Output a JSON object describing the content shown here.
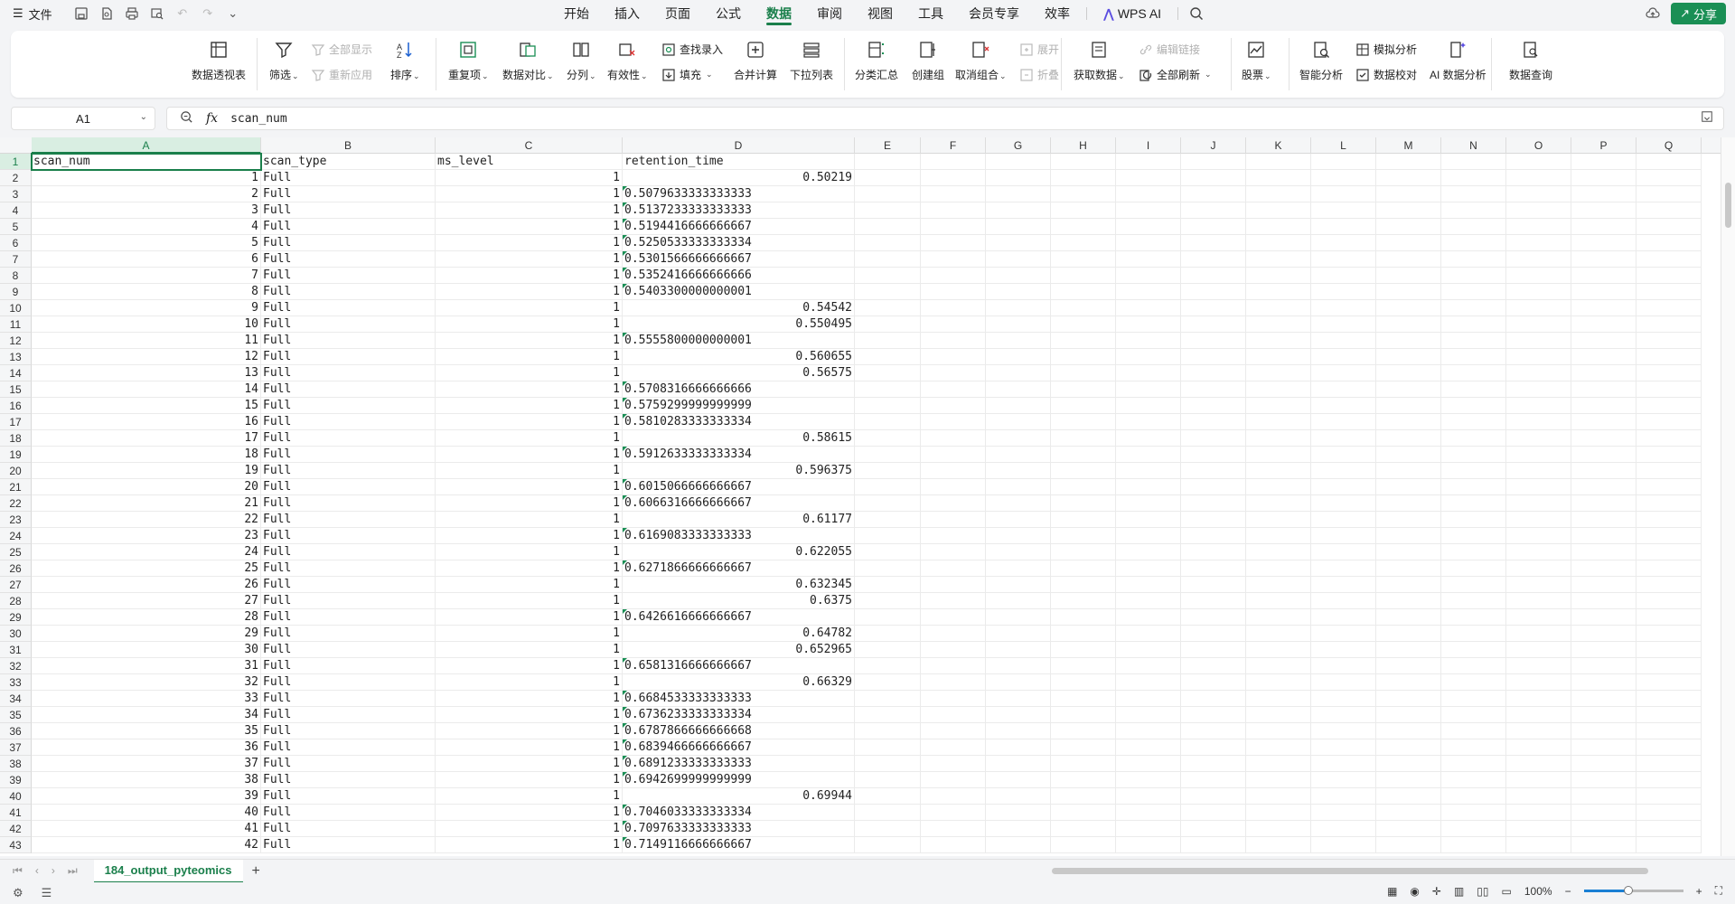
{
  "menubar": {
    "file_label": "文件",
    "menus": [
      {
        "label": "开始",
        "active": false
      },
      {
        "label": "插入",
        "active": false
      },
      {
        "label": "页面",
        "active": false
      },
      {
        "label": "公式",
        "active": false
      },
      {
        "label": "数据",
        "active": true
      },
      {
        "label": "审阅",
        "active": false
      },
      {
        "label": "视图",
        "active": false
      },
      {
        "label": "工具",
        "active": false
      },
      {
        "label": "会员专享",
        "active": false
      },
      {
        "label": "效率",
        "active": false
      }
    ],
    "wps_ai_label": "WPS AI",
    "share_label": "分享"
  },
  "ribbon": {
    "pivot": "数据透视表",
    "filter": "筛选",
    "show_all": "全部显示",
    "reapply": "重新应用",
    "sort": "排序",
    "duplicates": "重复项",
    "compare": "数据对比",
    "split": "分列",
    "validity": "有效性",
    "find_entry": "查找录入",
    "fill": "填充",
    "consolidate": "合并计算",
    "dropdown": "下拉列表",
    "subtotal": "分类汇总",
    "group": "创建组",
    "ungroup": "取消组合",
    "expand": "展开",
    "collapse": "折叠",
    "get_data": "获取数据",
    "edit_links": "编辑链接",
    "refresh_all": "全部刷新",
    "stocks": "股票",
    "smart_analysis": "智能分析",
    "simulate": "模拟分析",
    "verify": "数据校对",
    "ai_analysis": "AI 数据分析",
    "query": "数据查询"
  },
  "formula_bar": {
    "name_box": "A1",
    "fx_label": "fx",
    "content": "scan_num"
  },
  "grid": {
    "columns": [
      "A",
      "B",
      "C",
      "D",
      "E",
      "F",
      "G",
      "H",
      "I",
      "J",
      "K",
      "L",
      "M",
      "N",
      "O",
      "P",
      "Q"
    ],
    "header_row": [
      "scan_num",
      "scan_type",
      "ms_level",
      "retention_time"
    ],
    "rows": [
      [
        "1",
        "Full",
        "1",
        "0.50219"
      ],
      [
        "2",
        "Full",
        "1",
        "0.5079633333333333"
      ],
      [
        "3",
        "Full",
        "1",
        "0.5137233333333333"
      ],
      [
        "4",
        "Full",
        "1",
        "0.5194416666666667"
      ],
      [
        "5",
        "Full",
        "1",
        "0.5250533333333334"
      ],
      [
        "6",
        "Full",
        "1",
        "0.5301566666666667"
      ],
      [
        "7",
        "Full",
        "1",
        "0.5352416666666666"
      ],
      [
        "8",
        "Full",
        "1",
        "0.5403300000000001"
      ],
      [
        "9",
        "Full",
        "1",
        "0.54542"
      ],
      [
        "10",
        "Full",
        "1",
        "0.550495"
      ],
      [
        "11",
        "Full",
        "1",
        "0.5555800000000001"
      ],
      [
        "12",
        "Full",
        "1",
        "0.560655"
      ],
      [
        "13",
        "Full",
        "1",
        "0.56575"
      ],
      [
        "14",
        "Full",
        "1",
        "0.5708316666666666"
      ],
      [
        "15",
        "Full",
        "1",
        "0.5759299999999999"
      ],
      [
        "16",
        "Full",
        "1",
        "0.5810283333333334"
      ],
      [
        "17",
        "Full",
        "1",
        "0.58615"
      ],
      [
        "18",
        "Full",
        "1",
        "0.5912633333333334"
      ],
      [
        "19",
        "Full",
        "1",
        "0.596375"
      ],
      [
        "20",
        "Full",
        "1",
        "0.6015066666666667"
      ],
      [
        "21",
        "Full",
        "1",
        "0.6066316666666667"
      ],
      [
        "22",
        "Full",
        "1",
        "0.61177"
      ],
      [
        "23",
        "Full",
        "1",
        "0.6169083333333333"
      ],
      [
        "24",
        "Full",
        "1",
        "0.622055"
      ],
      [
        "25",
        "Full",
        "1",
        "0.6271866666666667"
      ],
      [
        "26",
        "Full",
        "1",
        "0.632345"
      ],
      [
        "27",
        "Full",
        "1",
        "0.6375"
      ],
      [
        "28",
        "Full",
        "1",
        "0.6426616666666667"
      ],
      [
        "29",
        "Full",
        "1",
        "0.64782"
      ],
      [
        "30",
        "Full",
        "1",
        "0.652965"
      ],
      [
        "31",
        "Full",
        "1",
        "0.6581316666666667"
      ],
      [
        "32",
        "Full",
        "1",
        "0.66329"
      ],
      [
        "33",
        "Full",
        "1",
        "0.6684533333333333"
      ],
      [
        "34",
        "Full",
        "1",
        "0.6736233333333334"
      ],
      [
        "35",
        "Full",
        "1",
        "0.6787866666666668"
      ],
      [
        "36",
        "Full",
        "1",
        "0.6839466666666667"
      ],
      [
        "37",
        "Full",
        "1",
        "0.6891233333333333"
      ],
      [
        "38",
        "Full",
        "1",
        "0.6942699999999999"
      ],
      [
        "39",
        "Full",
        "1",
        "0.69944"
      ],
      [
        "40",
        "Full",
        "1",
        "0.7046033333333334"
      ],
      [
        "41",
        "Full",
        "1",
        "0.7097633333333333"
      ],
      [
        "42",
        "Full",
        "1",
        "0.7149116666666667"
      ]
    ]
  },
  "sheet_tabs": {
    "active": "184_output_pyteomics",
    "add_label": "+"
  },
  "status": {
    "zoom": "100%",
    "zoom_fraction": 0.45
  },
  "colors": {
    "accent": "#1a7f4b",
    "share": "#1a8f55"
  }
}
